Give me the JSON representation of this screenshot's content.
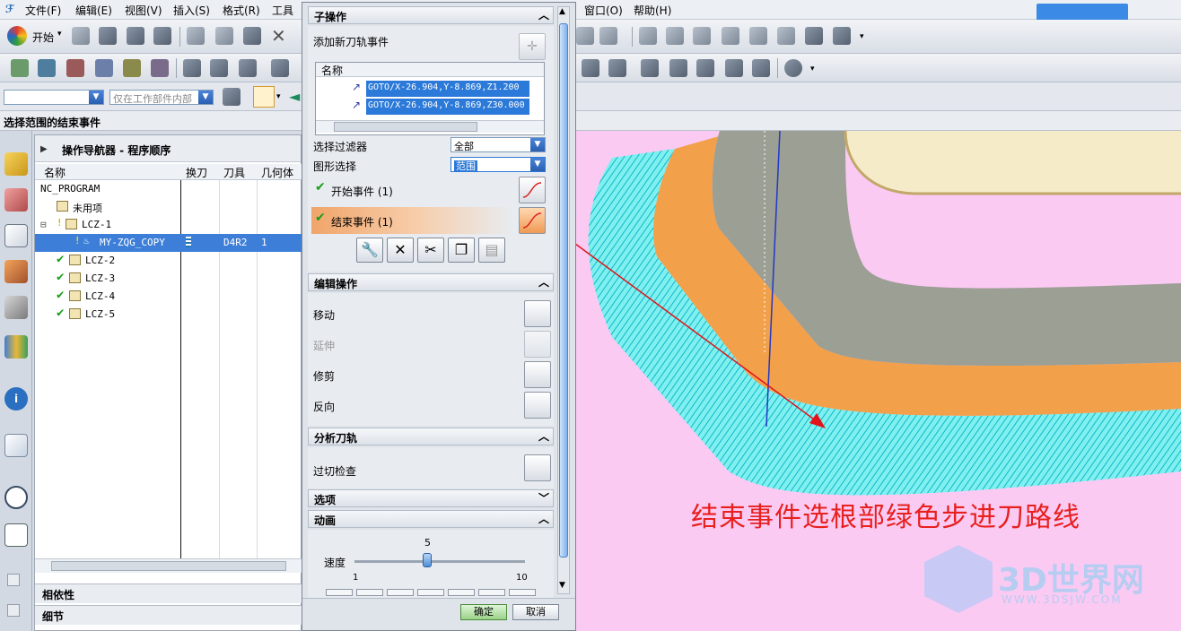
{
  "menubar": {
    "items": [
      {
        "label": "文件(F)",
        "x": 0
      },
      {
        "label": "编辑(E)"
      },
      {
        "label": "视图(V)"
      },
      {
        "label": "插入(S)"
      },
      {
        "label": "格式(R)"
      },
      {
        "label": "工具"
      },
      {
        "label": "窗口(O)"
      },
      {
        "label": "帮助(H)"
      }
    ],
    "start_label": "开始"
  },
  "selection_bar": {
    "filter_placeholder": "仅在工作部件内部",
    "prompt": "选择范围的结束事件"
  },
  "navigator": {
    "title": "操作导航器 - 程序顺序",
    "columns": [
      "名称",
      "换刀",
      "刀具",
      "几何体"
    ],
    "rows": [
      {
        "name": "NC_PROGRAM",
        "tool_change": "",
        "tool": "",
        "geometry": ""
      },
      {
        "name": "未用项",
        "tool_change": "",
        "tool": "",
        "geometry": ""
      },
      {
        "name": "LCZ-1",
        "tool_change": "",
        "tool": "",
        "geometry": ""
      },
      {
        "name": "MY-ZQG_COPY",
        "tool_change": "",
        "tool": "D4R2",
        "geometry": "1"
      },
      {
        "name": "LCZ-2",
        "tool_change": "",
        "tool": "",
        "geometry": ""
      },
      {
        "name": "LCZ-3",
        "tool_change": "",
        "tool": "",
        "geometry": ""
      },
      {
        "name": "LCZ-4",
        "tool_change": "",
        "tool": "",
        "geometry": ""
      },
      {
        "name": "LCZ-5",
        "tool_change": "",
        "tool": "",
        "geometry": ""
      }
    ],
    "bottom_panels": [
      "相依性",
      "细节"
    ]
  },
  "dialog": {
    "sub_ops": {
      "title": "子操作",
      "add_event_label": "添加新刀轨事件",
      "list_header": "名称",
      "events": [
        "GOTO/X-26.904,Y-8.869,Z1.200",
        "GOTO/X-26.904,Y-8.869,Z30.000"
      ],
      "filter_label": "选择过滤器",
      "filter_value": "全部",
      "shape_label": "图形选择",
      "shape_value": "范围",
      "start_event": "开始事件 (1)",
      "end_event": "结束事件 (1)"
    },
    "edit_ops": {
      "title": "编辑操作",
      "move": "移动",
      "extend": "延伸",
      "trim": "修剪",
      "reverse": "反向"
    },
    "analyze": {
      "title": "分析刀轨",
      "gouge_check": "过切检查"
    },
    "options": {
      "title": "选项"
    },
    "animation": {
      "title": "动画",
      "speed_label": "速度",
      "speed_value": "5",
      "speed_min": "1",
      "speed_max": "10"
    },
    "ok_label": "确定",
    "cancel_label": "取消"
  },
  "viewport": {
    "callout": "结束事件选根部绿色步进刀路线",
    "watermark_main": "3D世界网",
    "watermark_sub": "WWW.3DSJW.COM"
  },
  "colors": {
    "selection_blue": "#3d7fd8",
    "viewport_bg": "#fbcaf3",
    "orange_face": "#f2a04a",
    "callout_red": "#e8201e",
    "toolpath_cyan": "#19e0e6"
  }
}
